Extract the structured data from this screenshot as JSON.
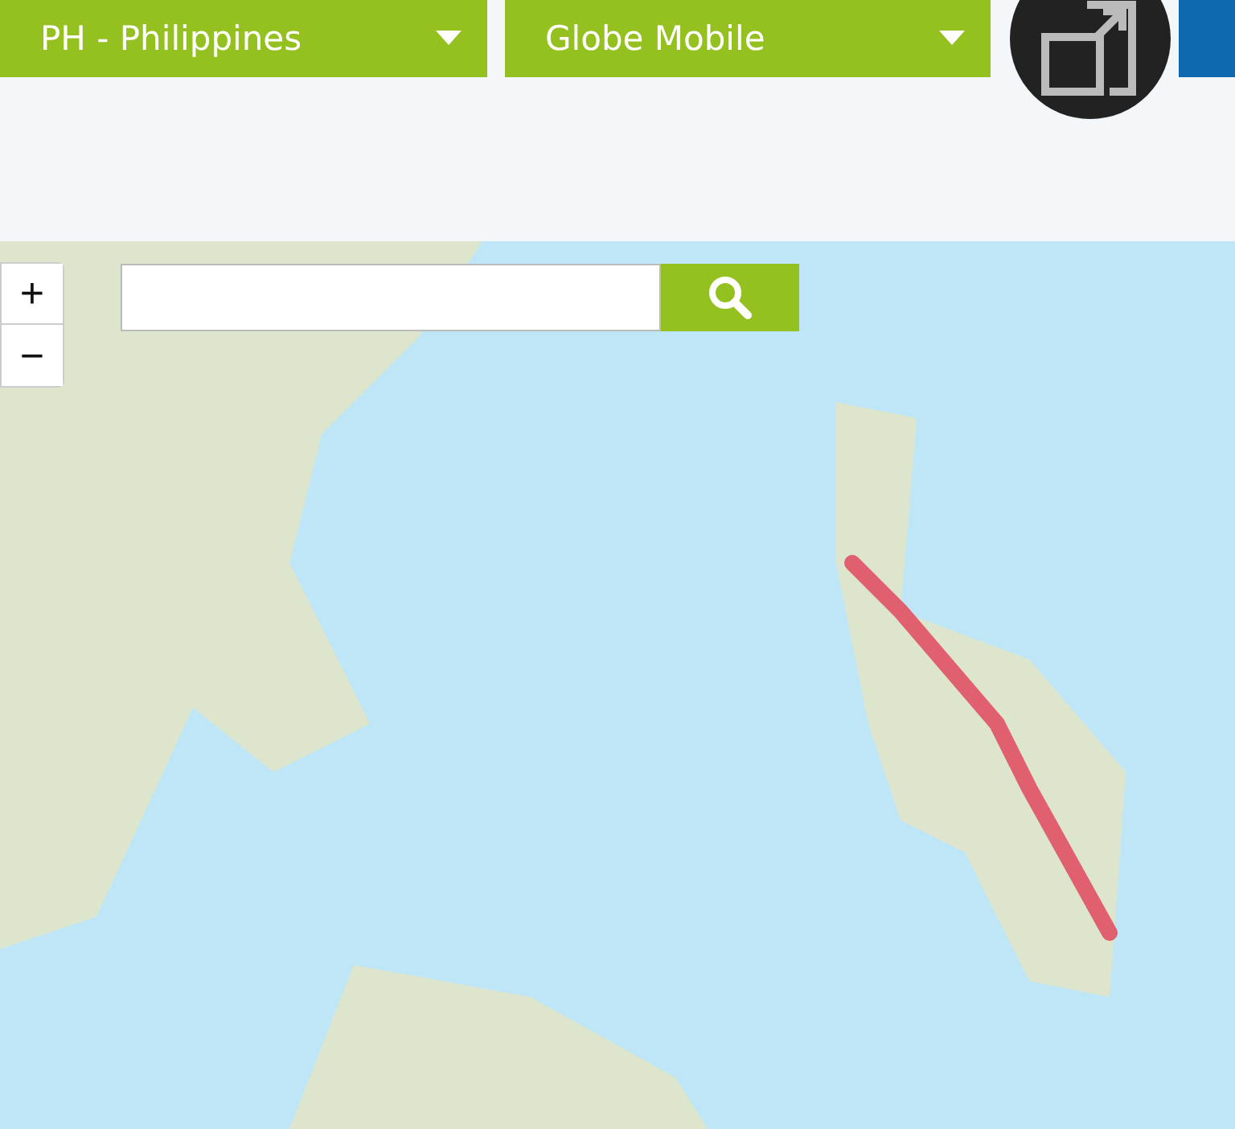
{
  "selectors": [
    {
      "value": "PH - Philippines"
    },
    {
      "value": "Globe Mobile"
    }
  ],
  "map": {
    "zoom_in": "+",
    "zoom_out": "−"
  }
}
